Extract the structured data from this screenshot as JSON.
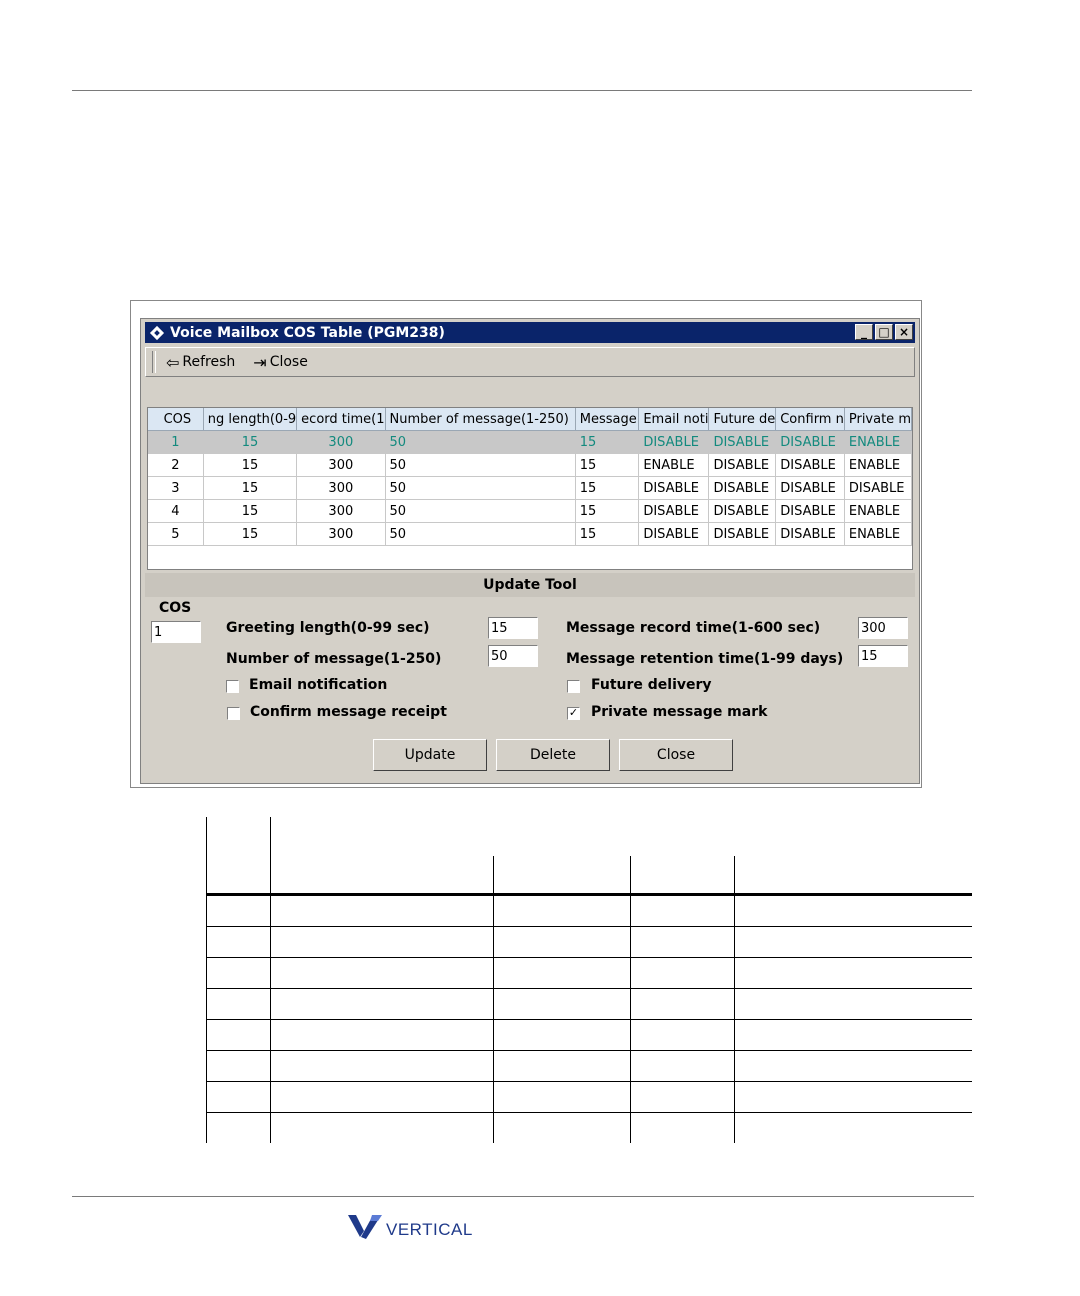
{
  "window": {
    "title": "Voice Mailbox COS Table (PGM238)",
    "buttons": {
      "minimize": "_",
      "maximize": "□",
      "close": "×"
    }
  },
  "toolbar": {
    "refresh_label": "Refresh",
    "close_label": "Close"
  },
  "grid": {
    "headers": [
      "COS",
      "ng length(0-9",
      "ecord time(1",
      "Number of message(1-250)",
      "Message",
      "Email noti",
      "Future de",
      "Confirm n",
      "Private m"
    ],
    "rows": [
      [
        "1",
        "15",
        "300",
        "50",
        "15",
        "DISABLE",
        "DISABLE",
        "DISABLE",
        "ENABLE"
      ],
      [
        "2",
        "15",
        "300",
        "50",
        "15",
        "ENABLE",
        "DISABLE",
        "DISABLE",
        "ENABLE"
      ],
      [
        "3",
        "15",
        "300",
        "50",
        "15",
        "DISABLE",
        "DISABLE",
        "DISABLE",
        "DISABLE"
      ],
      [
        "4",
        "15",
        "300",
        "50",
        "15",
        "DISABLE",
        "DISABLE",
        "DISABLE",
        "ENABLE"
      ],
      [
        "5",
        "15",
        "300",
        "50",
        "15",
        "DISABLE",
        "DISABLE",
        "DISABLE",
        "ENABLE"
      ]
    ],
    "selected_text_color": "#138a7e"
  },
  "update_tool": {
    "title": "Update Tool",
    "cos_label": "COS",
    "cos_value": "1",
    "greeting_label": "Greeting length(0-99 sec)",
    "greeting_value": "15",
    "record_label": "Message record time(1-600 sec)",
    "record_value": "300",
    "number_label": "Number of message(1-250)",
    "number_value": "50",
    "retention_label": "Message retention time(1-99 days)",
    "retention_value": "15",
    "email_label": "Email notification",
    "email_checked": false,
    "future_label": "Future delivery",
    "future_checked": false,
    "confirm_label": "Confirm message receipt",
    "confirm_checked": false,
    "private_label": "Private message mark",
    "private_checked": true,
    "check_mark": "✓",
    "update_button": "Update",
    "delete_button": "Delete",
    "close_button": "Close"
  },
  "footer": {
    "logo_text": "VERTICAL",
    "logo_color": "#1f3a8a"
  }
}
